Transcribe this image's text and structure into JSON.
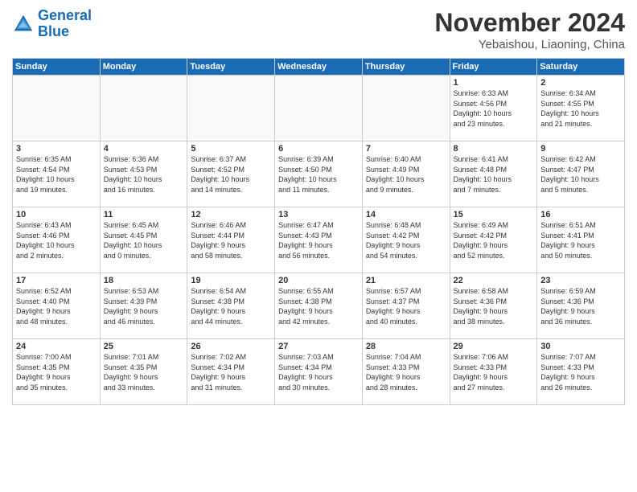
{
  "logo": {
    "line1": "General",
    "line2": "Blue"
  },
  "title": "November 2024",
  "location": "Yebaishou, Liaoning, China",
  "days_of_week": [
    "Sunday",
    "Monday",
    "Tuesday",
    "Wednesday",
    "Thursday",
    "Friday",
    "Saturday"
  ],
  "weeks": [
    [
      {
        "day": "",
        "info": ""
      },
      {
        "day": "",
        "info": ""
      },
      {
        "day": "",
        "info": ""
      },
      {
        "day": "",
        "info": ""
      },
      {
        "day": "",
        "info": ""
      },
      {
        "day": "1",
        "info": "Sunrise: 6:33 AM\nSunset: 4:56 PM\nDaylight: 10 hours\nand 23 minutes."
      },
      {
        "day": "2",
        "info": "Sunrise: 6:34 AM\nSunset: 4:55 PM\nDaylight: 10 hours\nand 21 minutes."
      }
    ],
    [
      {
        "day": "3",
        "info": "Sunrise: 6:35 AM\nSunset: 4:54 PM\nDaylight: 10 hours\nand 19 minutes."
      },
      {
        "day": "4",
        "info": "Sunrise: 6:36 AM\nSunset: 4:53 PM\nDaylight: 10 hours\nand 16 minutes."
      },
      {
        "day": "5",
        "info": "Sunrise: 6:37 AM\nSunset: 4:52 PM\nDaylight: 10 hours\nand 14 minutes."
      },
      {
        "day": "6",
        "info": "Sunrise: 6:39 AM\nSunset: 4:50 PM\nDaylight: 10 hours\nand 11 minutes."
      },
      {
        "day": "7",
        "info": "Sunrise: 6:40 AM\nSunset: 4:49 PM\nDaylight: 10 hours\nand 9 minutes."
      },
      {
        "day": "8",
        "info": "Sunrise: 6:41 AM\nSunset: 4:48 PM\nDaylight: 10 hours\nand 7 minutes."
      },
      {
        "day": "9",
        "info": "Sunrise: 6:42 AM\nSunset: 4:47 PM\nDaylight: 10 hours\nand 5 minutes."
      }
    ],
    [
      {
        "day": "10",
        "info": "Sunrise: 6:43 AM\nSunset: 4:46 PM\nDaylight: 10 hours\nand 2 minutes."
      },
      {
        "day": "11",
        "info": "Sunrise: 6:45 AM\nSunset: 4:45 PM\nDaylight: 10 hours\nand 0 minutes."
      },
      {
        "day": "12",
        "info": "Sunrise: 6:46 AM\nSunset: 4:44 PM\nDaylight: 9 hours\nand 58 minutes."
      },
      {
        "day": "13",
        "info": "Sunrise: 6:47 AM\nSunset: 4:43 PM\nDaylight: 9 hours\nand 56 minutes."
      },
      {
        "day": "14",
        "info": "Sunrise: 6:48 AM\nSunset: 4:42 PM\nDaylight: 9 hours\nand 54 minutes."
      },
      {
        "day": "15",
        "info": "Sunrise: 6:49 AM\nSunset: 4:42 PM\nDaylight: 9 hours\nand 52 minutes."
      },
      {
        "day": "16",
        "info": "Sunrise: 6:51 AM\nSunset: 4:41 PM\nDaylight: 9 hours\nand 50 minutes."
      }
    ],
    [
      {
        "day": "17",
        "info": "Sunrise: 6:52 AM\nSunset: 4:40 PM\nDaylight: 9 hours\nand 48 minutes."
      },
      {
        "day": "18",
        "info": "Sunrise: 6:53 AM\nSunset: 4:39 PM\nDaylight: 9 hours\nand 46 minutes."
      },
      {
        "day": "19",
        "info": "Sunrise: 6:54 AM\nSunset: 4:38 PM\nDaylight: 9 hours\nand 44 minutes."
      },
      {
        "day": "20",
        "info": "Sunrise: 6:55 AM\nSunset: 4:38 PM\nDaylight: 9 hours\nand 42 minutes."
      },
      {
        "day": "21",
        "info": "Sunrise: 6:57 AM\nSunset: 4:37 PM\nDaylight: 9 hours\nand 40 minutes."
      },
      {
        "day": "22",
        "info": "Sunrise: 6:58 AM\nSunset: 4:36 PM\nDaylight: 9 hours\nand 38 minutes."
      },
      {
        "day": "23",
        "info": "Sunrise: 6:59 AM\nSunset: 4:36 PM\nDaylight: 9 hours\nand 36 minutes."
      }
    ],
    [
      {
        "day": "24",
        "info": "Sunrise: 7:00 AM\nSunset: 4:35 PM\nDaylight: 9 hours\nand 35 minutes."
      },
      {
        "day": "25",
        "info": "Sunrise: 7:01 AM\nSunset: 4:35 PM\nDaylight: 9 hours\nand 33 minutes."
      },
      {
        "day": "26",
        "info": "Sunrise: 7:02 AM\nSunset: 4:34 PM\nDaylight: 9 hours\nand 31 minutes."
      },
      {
        "day": "27",
        "info": "Sunrise: 7:03 AM\nSunset: 4:34 PM\nDaylight: 9 hours\nand 30 minutes."
      },
      {
        "day": "28",
        "info": "Sunrise: 7:04 AM\nSunset: 4:33 PM\nDaylight: 9 hours\nand 28 minutes."
      },
      {
        "day": "29",
        "info": "Sunrise: 7:06 AM\nSunset: 4:33 PM\nDaylight: 9 hours\nand 27 minutes."
      },
      {
        "day": "30",
        "info": "Sunrise: 7:07 AM\nSunset: 4:33 PM\nDaylight: 9 hours\nand 26 minutes."
      }
    ]
  ]
}
